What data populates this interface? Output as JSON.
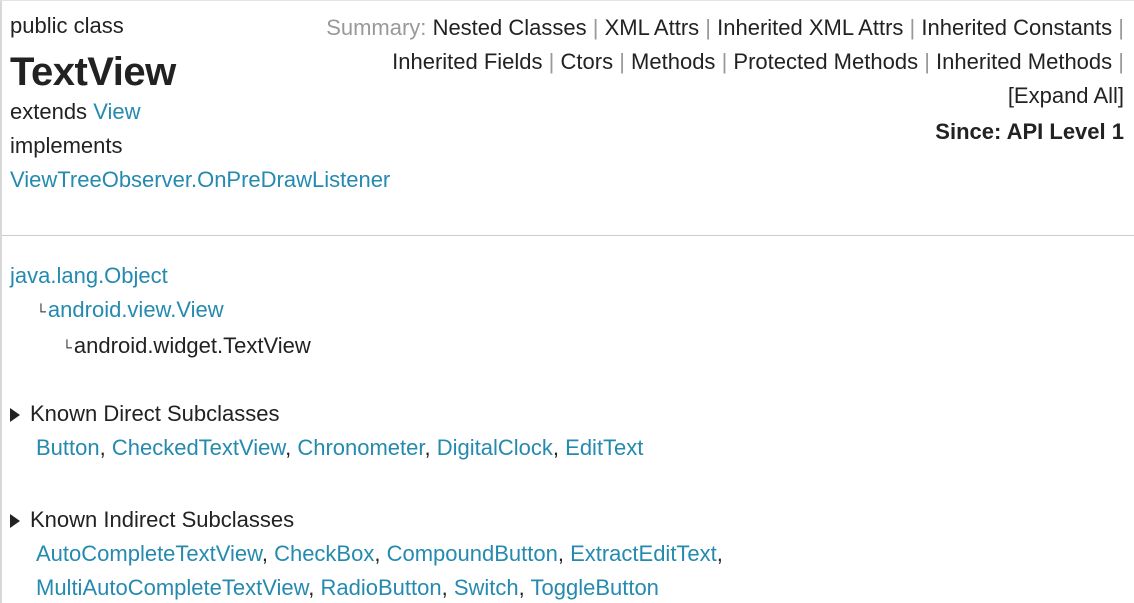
{
  "header": {
    "modifiers": "public class",
    "class_name": "TextView",
    "extends_label": "extends",
    "extends_link": "View",
    "implements_label": "implements",
    "implements_link": "ViewTreeObserver.OnPreDrawListener"
  },
  "summary": {
    "label": "Summary:",
    "separator": "|",
    "links": [
      "Nested Classes",
      "XML Attrs",
      "Inherited XML Attrs",
      "Inherited Constants",
      "Inherited Fields",
      "Ctors",
      "Methods",
      "Protected Methods",
      "Inherited Methods",
      "[Expand All]"
    ],
    "since": "Since: API Level 1"
  },
  "inheritance": {
    "corner_glyph": "└",
    "root": "java.lang.Object",
    "parent": "android.view.View",
    "current": "android.widget.TextView"
  },
  "direct_subclasses": {
    "heading": "Known Direct Subclasses",
    "items": [
      "Button",
      "CheckedTextView",
      "Chronometer",
      "DigitalClock",
      "EditText"
    ]
  },
  "indirect_subclasses": {
    "heading": "Known Indirect Subclasses",
    "line1": [
      "AutoCompleteTextView",
      "CheckBox",
      "CompoundButton",
      "ExtractEditText"
    ],
    "line2": [
      "MultiAutoCompleteTextView",
      "RadioButton",
      "Switch",
      "ToggleButton"
    ]
  }
}
